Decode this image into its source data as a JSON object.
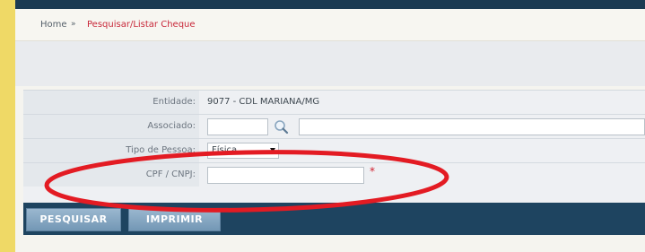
{
  "breadcrumb": {
    "home": "Home",
    "separator": "»",
    "current": "Pesquisar/Listar Cheque"
  },
  "form": {
    "entidade": {
      "label": "Entidade:",
      "value": "9077  -  CDL MARIANA/MG"
    },
    "associado": {
      "label": "Associado:",
      "code_value": "",
      "name_value": ""
    },
    "tipo_pessoa": {
      "label": "Tipo de Pessoa:",
      "selected": "Física"
    },
    "cpf_cnpj": {
      "label": "CPF / CNPJ:",
      "value": "",
      "required_mark": "*"
    }
  },
  "actions": {
    "pesquisar": "PESQUISAR",
    "imprimir": "IMPRIMIR"
  },
  "colors": {
    "background": "#efd966",
    "header_bar": "#1b3a52",
    "action_bar": "#1e4460",
    "breadcrumb_current": "#c8283a",
    "annotation_ellipse": "#e31b23"
  },
  "icons": {
    "lookup": "magnifier-icon",
    "dropdown": "chevron-down-icon"
  }
}
